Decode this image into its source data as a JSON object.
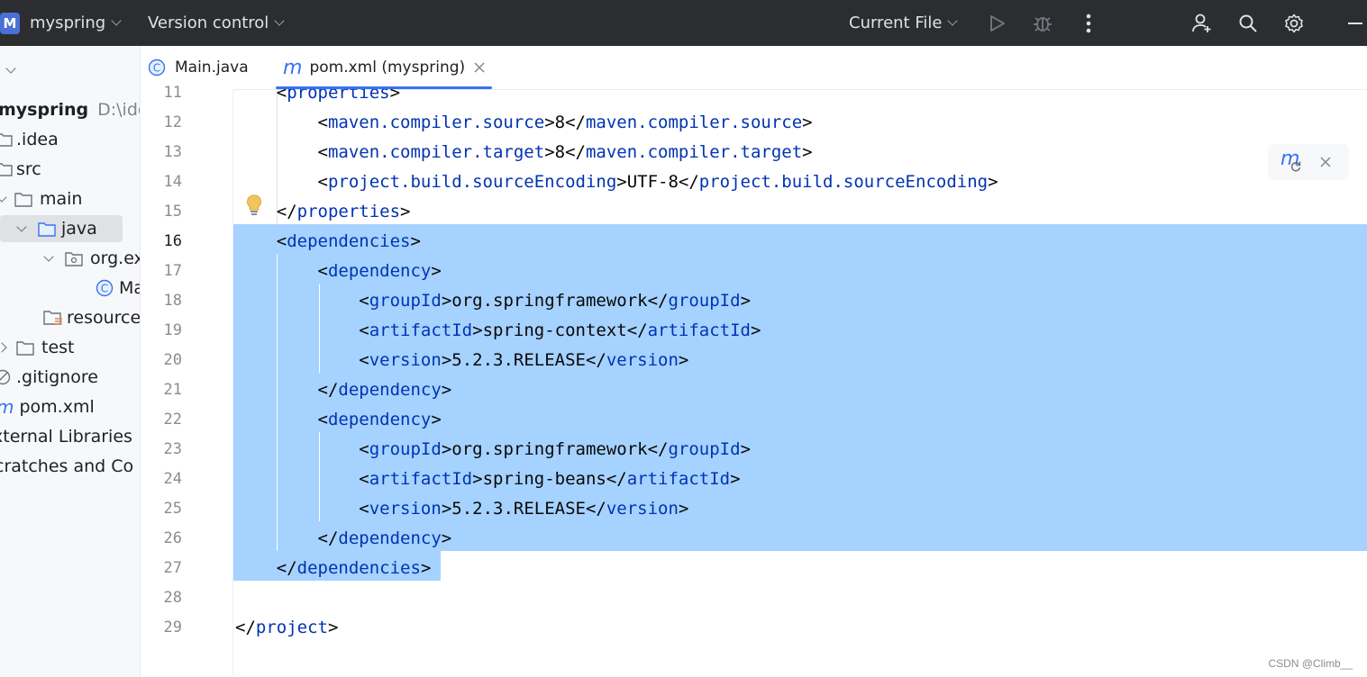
{
  "topbar": {
    "project_badge": "M",
    "project_name": "myspring",
    "vcs_label": "Version control",
    "run_config": "Current File",
    "icons": [
      "run-icon",
      "debug-icon",
      "more-icon",
      "add-user-icon",
      "search-icon",
      "settings-icon",
      "minimize-icon"
    ]
  },
  "sidebar": {
    "items": [
      {
        "label": "myspring",
        "hint": "D:\\idea"
      },
      {
        "label": ".idea"
      },
      {
        "label": "src"
      },
      {
        "label": "main"
      },
      {
        "label": "java"
      },
      {
        "label": "org.ex"
      },
      {
        "label": "Ma"
      },
      {
        "label": "resource"
      },
      {
        "label": "test"
      },
      {
        "label": ".gitignore"
      },
      {
        "label": "pom.xml"
      },
      {
        "label": "xternal Libraries"
      },
      {
        "label": "cratches and Co"
      }
    ]
  },
  "tabs": [
    {
      "label": "Main.java",
      "icon": "class-icon"
    },
    {
      "label": "pom.xml (myspring)",
      "icon": "maven-icon"
    }
  ],
  "editor": {
    "line_numbers": [
      "11",
      "12",
      "13",
      "14",
      "15",
      "16",
      "17",
      "18",
      "19",
      "20",
      "21",
      "22",
      "23",
      "24",
      "25",
      "26",
      "27",
      "28",
      "29"
    ],
    "lines": [
      {
        "indent": "    ",
        "parts": [
          {
            "t": "<",
            "c": "txt"
          },
          {
            "t": "properties",
            "c": "tag"
          },
          {
            "t": ">",
            "c": "txt"
          }
        ]
      },
      {
        "indent": "        ",
        "parts": [
          {
            "t": "<",
            "c": "txt"
          },
          {
            "t": "maven.compiler.source",
            "c": "tag"
          },
          {
            "t": ">8</",
            "c": "txt"
          },
          {
            "t": "maven.compiler.source",
            "c": "tag"
          },
          {
            "t": ">",
            "c": "txt"
          }
        ]
      },
      {
        "indent": "        ",
        "parts": [
          {
            "t": "<",
            "c": "txt"
          },
          {
            "t": "maven.compiler.target",
            "c": "tag"
          },
          {
            "t": ">8</",
            "c": "txt"
          },
          {
            "t": "maven.compiler.target",
            "c": "tag"
          },
          {
            "t": ">",
            "c": "txt"
          }
        ]
      },
      {
        "indent": "        ",
        "parts": [
          {
            "t": "<",
            "c": "txt"
          },
          {
            "t": "project.build.sourceEncoding",
            "c": "tag"
          },
          {
            "t": ">UTF-8</",
            "c": "txt"
          },
          {
            "t": "project.build.sourceEncoding",
            "c": "tag"
          },
          {
            "t": ">",
            "c": "txt"
          }
        ]
      },
      {
        "indent": "    ",
        "parts": [
          {
            "t": "</",
            "c": "txt"
          },
          {
            "t": "properties",
            "c": "tag"
          },
          {
            "t": ">",
            "c": "txt"
          }
        ]
      },
      {
        "indent": "    ",
        "parts": [
          {
            "t": "<",
            "c": "txt"
          },
          {
            "t": "dependencies",
            "c": "tag"
          },
          {
            "t": ">",
            "c": "txt"
          }
        ]
      },
      {
        "indent": "        ",
        "parts": [
          {
            "t": "<",
            "c": "txt"
          },
          {
            "t": "dependency",
            "c": "tag"
          },
          {
            "t": ">",
            "c": "txt"
          }
        ]
      },
      {
        "indent": "            ",
        "parts": [
          {
            "t": "<",
            "c": "txt"
          },
          {
            "t": "groupId",
            "c": "tag"
          },
          {
            "t": ">org.springframework</",
            "c": "txt"
          },
          {
            "t": "groupId",
            "c": "tag"
          },
          {
            "t": ">",
            "c": "txt"
          }
        ]
      },
      {
        "indent": "            ",
        "parts": [
          {
            "t": "<",
            "c": "txt"
          },
          {
            "t": "artifactId",
            "c": "tag"
          },
          {
            "t": ">spring-context</",
            "c": "txt"
          },
          {
            "t": "artifactId",
            "c": "tag"
          },
          {
            "t": ">",
            "c": "txt"
          }
        ]
      },
      {
        "indent": "            ",
        "parts": [
          {
            "t": "<",
            "c": "txt"
          },
          {
            "t": "version",
            "c": "tag"
          },
          {
            "t": ">5.2.3.RELEASE</",
            "c": "txt"
          },
          {
            "t": "version",
            "c": "tag"
          },
          {
            "t": ">",
            "c": "txt"
          }
        ]
      },
      {
        "indent": "        ",
        "parts": [
          {
            "t": "</",
            "c": "txt"
          },
          {
            "t": "dependency",
            "c": "tag"
          },
          {
            "t": ">",
            "c": "txt"
          }
        ]
      },
      {
        "indent": "        ",
        "parts": [
          {
            "t": "<",
            "c": "txt"
          },
          {
            "t": "dependency",
            "c": "tag"
          },
          {
            "t": ">",
            "c": "txt"
          }
        ]
      },
      {
        "indent": "            ",
        "parts": [
          {
            "t": "<",
            "c": "txt"
          },
          {
            "t": "groupId",
            "c": "tag"
          },
          {
            "t": ">org.springframework</",
            "c": "txt"
          },
          {
            "t": "groupId",
            "c": "tag"
          },
          {
            "t": ">",
            "c": "txt"
          }
        ]
      },
      {
        "indent": "            ",
        "parts": [
          {
            "t": "<",
            "c": "txt"
          },
          {
            "t": "artifactId",
            "c": "tag"
          },
          {
            "t": ">spring-beans</",
            "c": "txt"
          },
          {
            "t": "artifactId",
            "c": "tag"
          },
          {
            "t": ">",
            "c": "txt"
          }
        ]
      },
      {
        "indent": "            ",
        "parts": [
          {
            "t": "<",
            "c": "txt"
          },
          {
            "t": "version",
            "c": "tag"
          },
          {
            "t": ">5.2.3.RELEASE</",
            "c": "txt"
          },
          {
            "t": "version",
            "c": "tag"
          },
          {
            "t": ">",
            "c": "txt"
          }
        ]
      },
      {
        "indent": "        ",
        "parts": [
          {
            "t": "</",
            "c": "txt"
          },
          {
            "t": "dependency",
            "c": "tag"
          },
          {
            "t": ">",
            "c": "txt"
          }
        ]
      },
      {
        "indent": "    ",
        "parts": [
          {
            "t": "</",
            "c": "txt"
          },
          {
            "t": "dependencies",
            "c": "tag"
          },
          {
            "t": ">",
            "c": "txt"
          }
        ]
      },
      {
        "indent": "",
        "parts": []
      },
      {
        "indent": "",
        "parts": [
          {
            "t": "</",
            "c": "txt"
          },
          {
            "t": "project",
            "c": "tag"
          },
          {
            "t": ">",
            "c": "txt"
          }
        ]
      }
    ]
  },
  "colors": {
    "topbar_bg": "#2b2d30",
    "accent": "#3574f0",
    "selection": "#a6d2ff",
    "tag": "#0033b3"
  },
  "watermark": "CSDN @Climb__"
}
